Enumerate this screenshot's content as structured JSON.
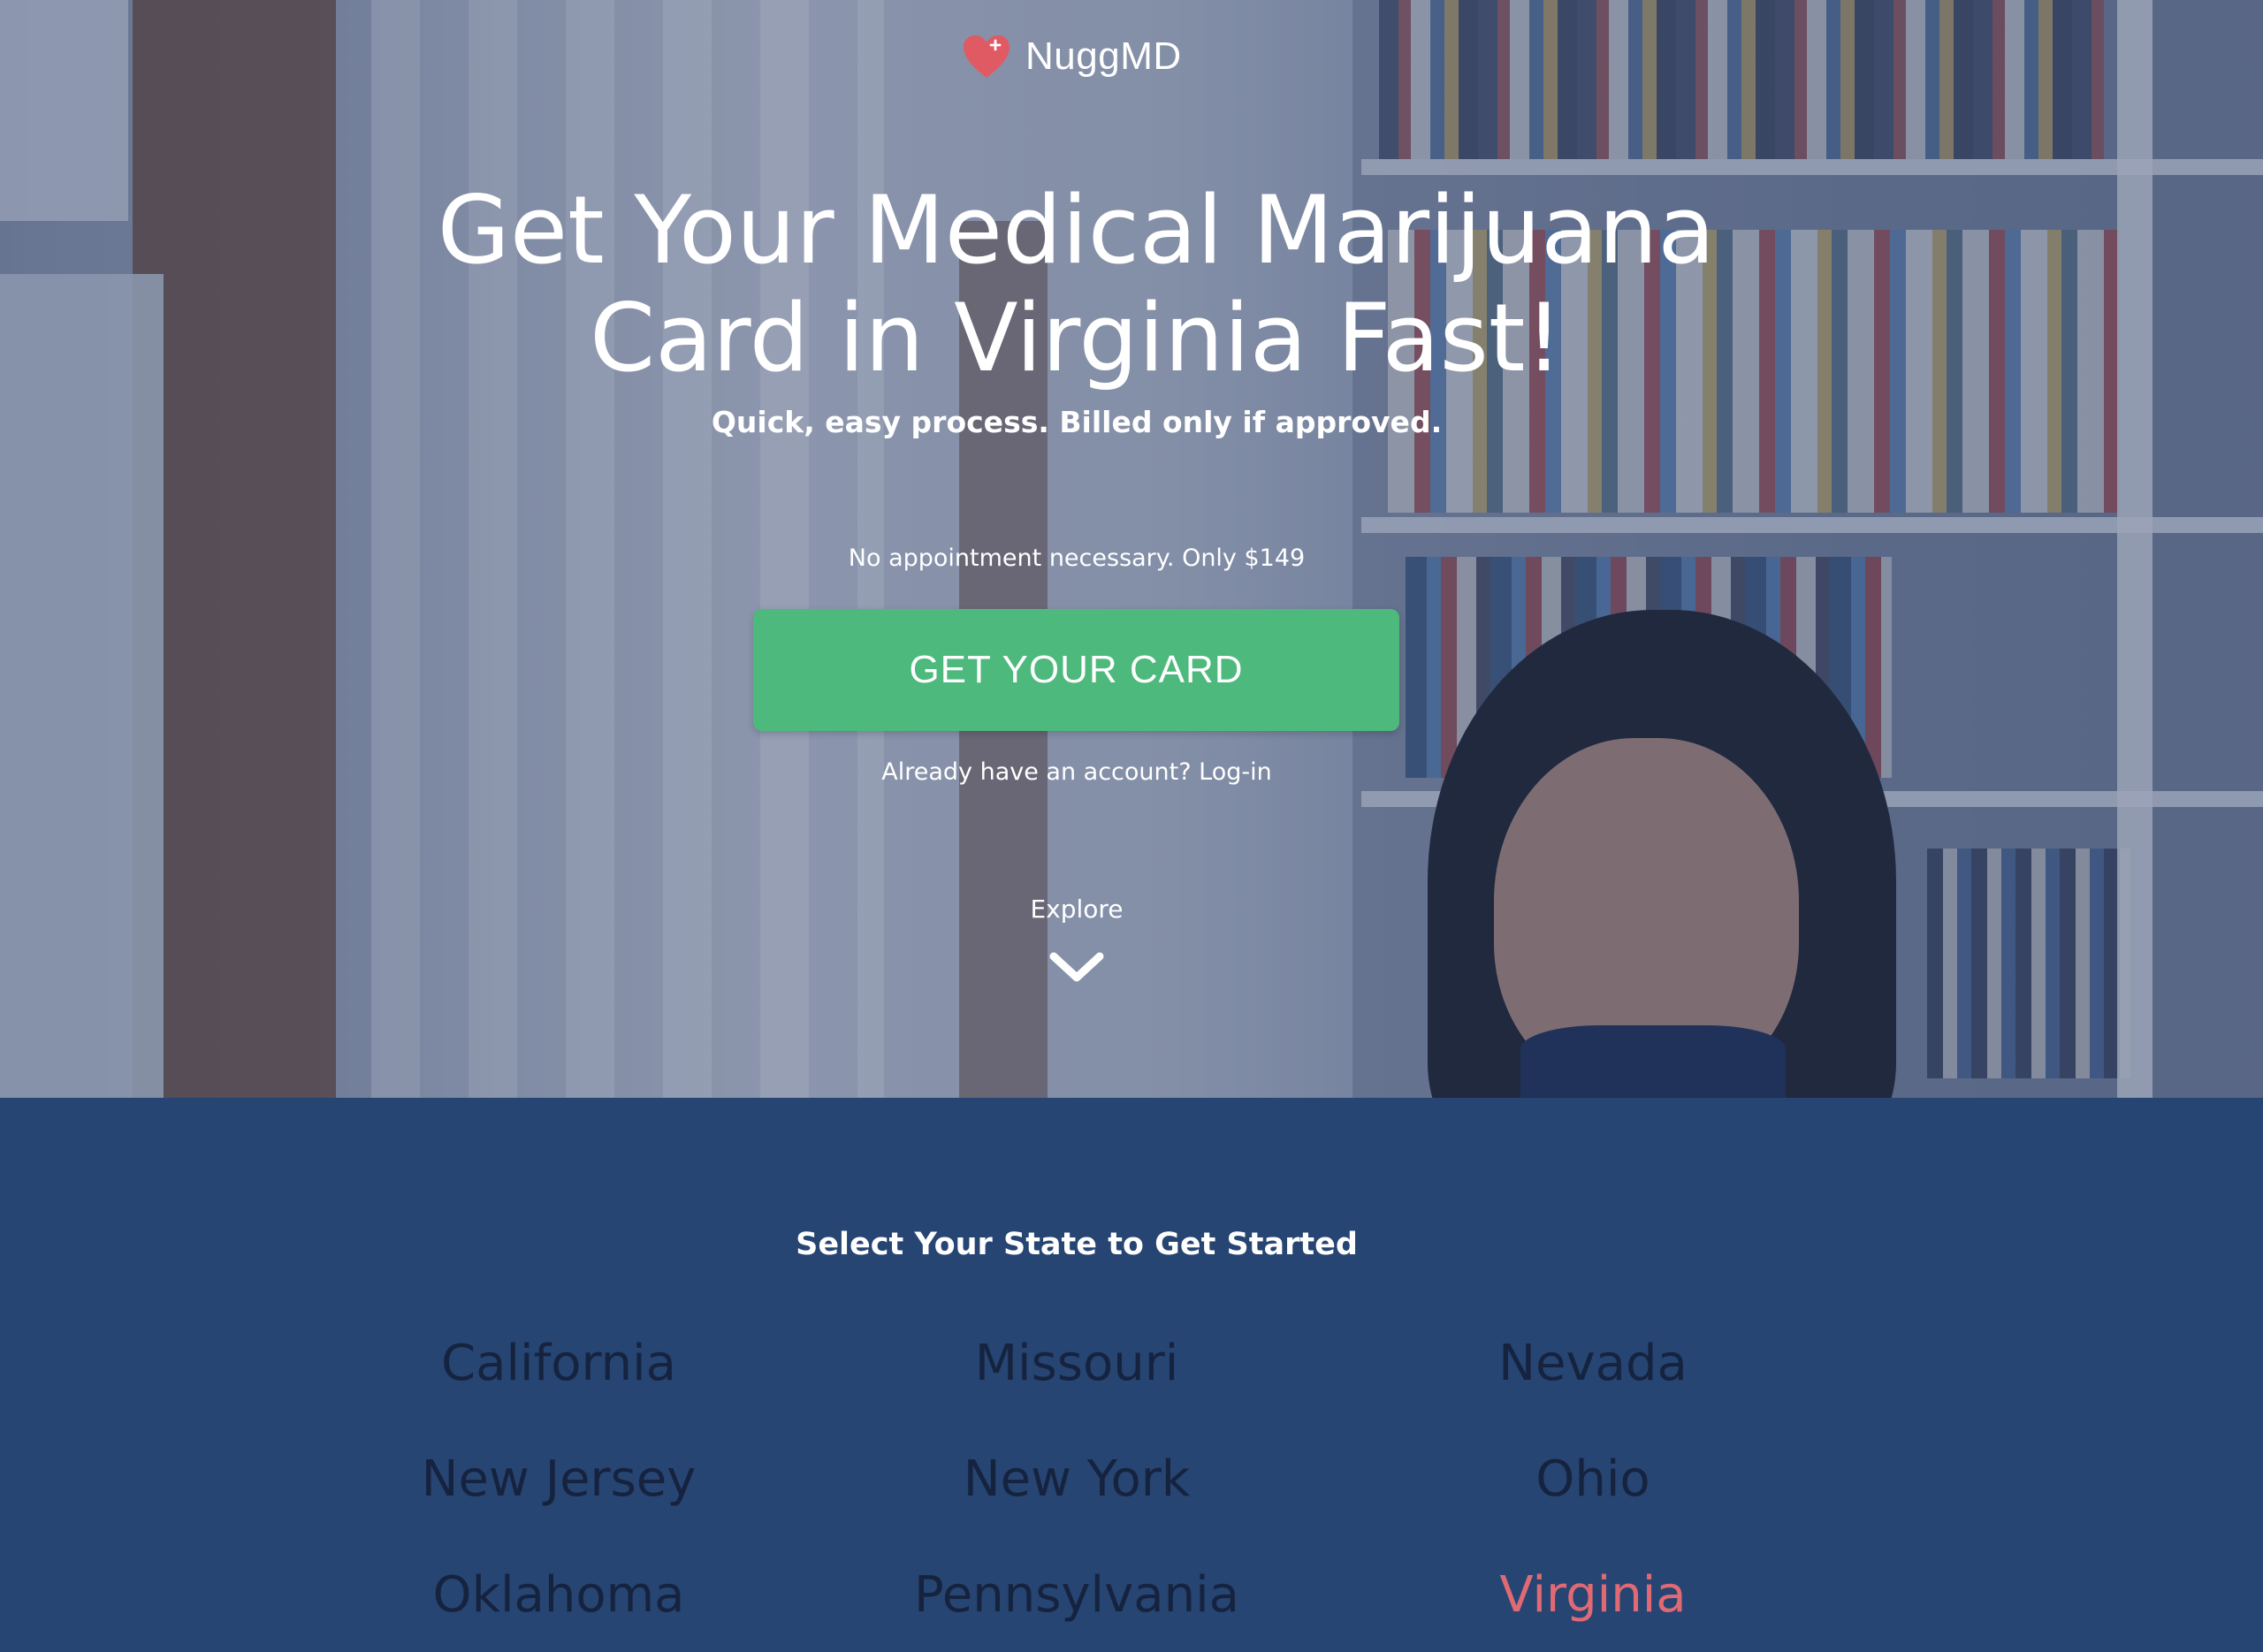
{
  "brand": {
    "name": "NuggMD",
    "logo_icon": "heart-plus-icon",
    "accent_color": "#e05a64"
  },
  "hero": {
    "headline_line1": "Get Your Medical Marijuana",
    "headline_line2": "Card in Virginia Fast!",
    "subheadline": "Quick, easy process. Billed only if approved.",
    "notice": "No appointment necessary. Only $149",
    "cta_label": "GET YOUR CARD",
    "cta_color": "#4eb97d",
    "login_prompt": "Already have an account? Log-in",
    "explore_label": "Explore",
    "explore_icon": "chevron-down-icon"
  },
  "states": {
    "title": "Select Your State to Get Started",
    "selected_color": "#e06a73",
    "items": [
      {
        "name": "California"
      },
      {
        "name": "Missouri"
      },
      {
        "name": "Nevada"
      },
      {
        "name": "New Jersey"
      },
      {
        "name": "New York"
      },
      {
        "name": "Ohio"
      },
      {
        "name": "Oklahoma"
      },
      {
        "name": "Pennsylvania"
      },
      {
        "name": "Virginia",
        "selected": true
      }
    ]
  }
}
